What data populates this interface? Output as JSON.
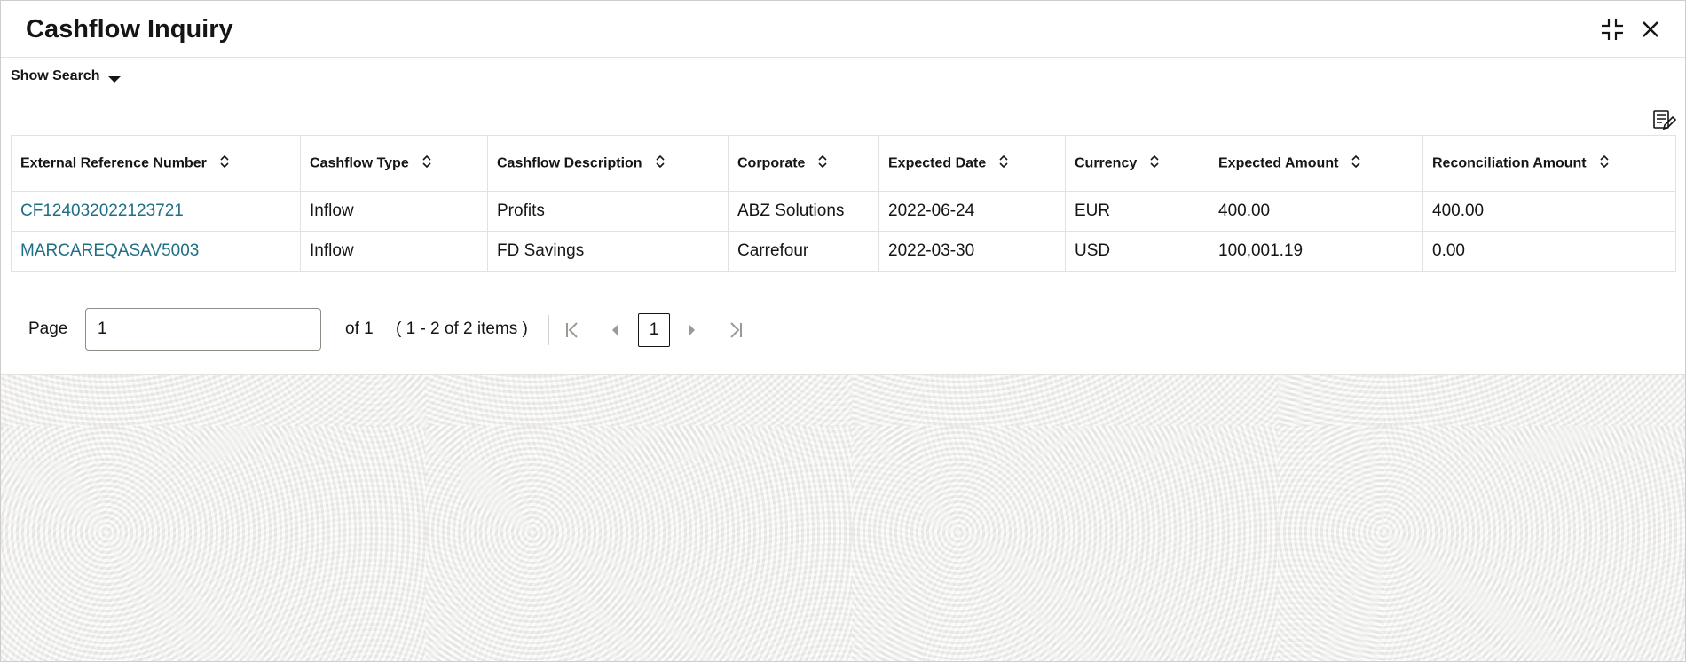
{
  "header": {
    "title": "Cashflow Inquiry"
  },
  "toolbar": {
    "show_search_label": "Show Search"
  },
  "table": {
    "columns": [
      "External Reference Number",
      "Cashflow Type",
      "Cashflow Description",
      "Corporate",
      "Expected Date",
      "Currency",
      "Expected Amount",
      "Reconciliation Amount"
    ],
    "rows": [
      [
        "CF124032022123721",
        "Inflow",
        "Profits",
        "ABZ Solutions",
        "2022-06-24",
        "EUR",
        "400.00",
        "400.00"
      ],
      [
        "MARCAREQASAV5003",
        "Inflow",
        "FD Savings",
        "Carrefour",
        "2022-03-30",
        "USD",
        "100,001.19",
        "0.00"
      ]
    ]
  },
  "pagination": {
    "page_label": "Page",
    "page_value": "1",
    "of_label": "of 1",
    "range_label": "( 1 - 2 of 2 items )",
    "current_page": "1"
  },
  "colors": {
    "link": "#1f6f86",
    "text": "#161513",
    "border": "#e4e2de"
  },
  "icons": {
    "minimize": "collapse-arrows-icon",
    "close": "close-icon",
    "show_search": "caret-down-icon",
    "columns": "column-settings-icon",
    "sort": "sort-icon",
    "first": "first-page-icon",
    "prev": "previous-page-icon",
    "next": "next-page-icon",
    "last": "last-page-icon"
  }
}
